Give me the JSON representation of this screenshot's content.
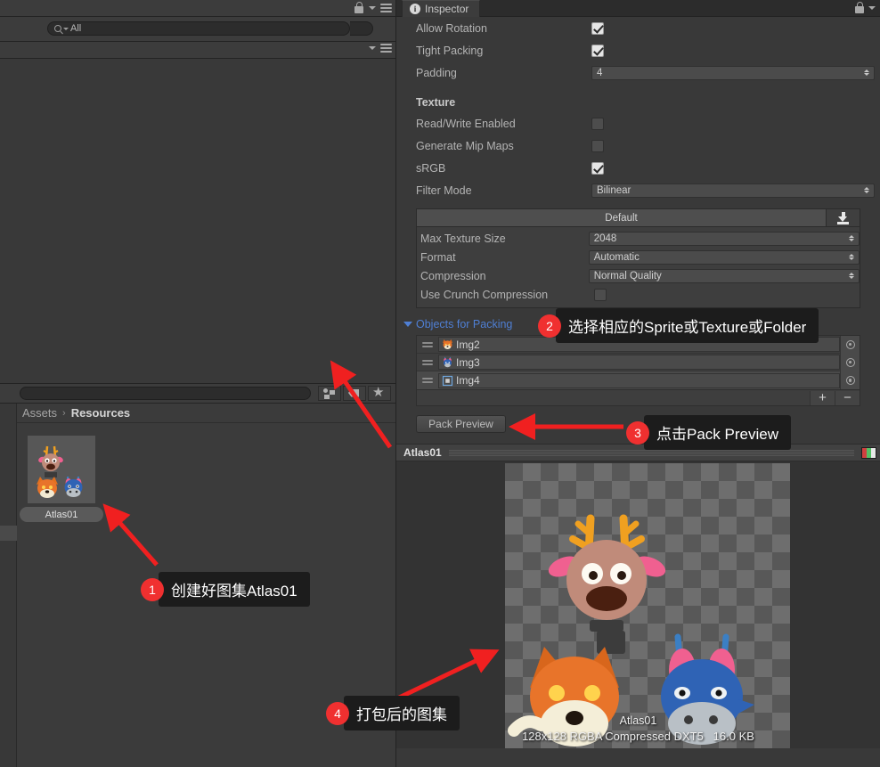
{
  "hierarchy": {
    "search": {
      "value": "All",
      "icon": "search-icon"
    },
    "lock_icon": "lock-icon",
    "menu_icon": "hamburger-menu-icon"
  },
  "project": {
    "breadcrumb": {
      "root": "Assets",
      "separator": "›",
      "current": "Resources"
    },
    "tools": [
      "object-filter-icon",
      "label-filter-icon",
      "favorite-star-icon"
    ],
    "assets": [
      {
        "name": "Atlas01",
        "type": "sprite-atlas"
      }
    ]
  },
  "inspector": {
    "tab": {
      "label": "Inspector",
      "icon": "info-icon"
    },
    "lock_icon": "lock-icon",
    "menu_icon": "hamburger-menu-icon",
    "packing_props": [
      {
        "label": "Allow Rotation",
        "control": "checkbox",
        "value": true
      },
      {
        "label": "Tight Packing",
        "control": "checkbox",
        "value": true
      },
      {
        "label": "Padding",
        "control": "number",
        "value": "4"
      }
    ],
    "texture_section": {
      "header": "Texture",
      "props": [
        {
          "label": "Read/Write Enabled",
          "control": "checkbox",
          "value": false
        },
        {
          "label": "Generate Mip Maps",
          "control": "checkbox",
          "value": false
        },
        {
          "label": "sRGB",
          "control": "checkbox",
          "value": true
        },
        {
          "label": "Filter Mode",
          "control": "dropdown",
          "value": "Bilinear"
        }
      ]
    },
    "platform": {
      "tab_label": "Default",
      "download_icon": "download-icon",
      "props": [
        {
          "label": "Max Texture Size",
          "control": "dropdown",
          "value": "2048"
        },
        {
          "label": "Format",
          "control": "dropdown",
          "value": "Automatic"
        },
        {
          "label": "Compression",
          "control": "dropdown",
          "value": "Normal Quality"
        },
        {
          "label": "Use Crunch Compression",
          "control": "checkbox",
          "value": false
        }
      ]
    },
    "objects_for_packing": {
      "foldout_label": "Objects for Packing",
      "foldout_expanded": true,
      "items": [
        {
          "name": "Img2",
          "icon": "fox-sprite-icon"
        },
        {
          "name": "Img3",
          "icon": "donkey-sprite-icon"
        },
        {
          "name": "Img4",
          "icon": "texture-icon"
        }
      ],
      "add_button": "+",
      "remove_button": "−"
    },
    "pack_preview_button": "Pack Preview",
    "preview": {
      "title": "Atlas01",
      "caption": "Atlas01",
      "info": "128x128 RGBA Compressed DXT5   16.0 KB",
      "rgba_swatch": "rgba-channel-icon"
    }
  },
  "annotations": [
    {
      "number": "1",
      "text": "创建好图集Atlas01"
    },
    {
      "number": "2",
      "text": "选择相应的Sprite或Texture或Folder"
    },
    {
      "number": "3",
      "text": "点击Pack Preview"
    },
    {
      "number": "4",
      "text": "打包后的图集"
    }
  ],
  "colors": {
    "accent_red": "#f03030",
    "foldout_blue": "#4f7fd4",
    "panel_bg": "#393939"
  }
}
